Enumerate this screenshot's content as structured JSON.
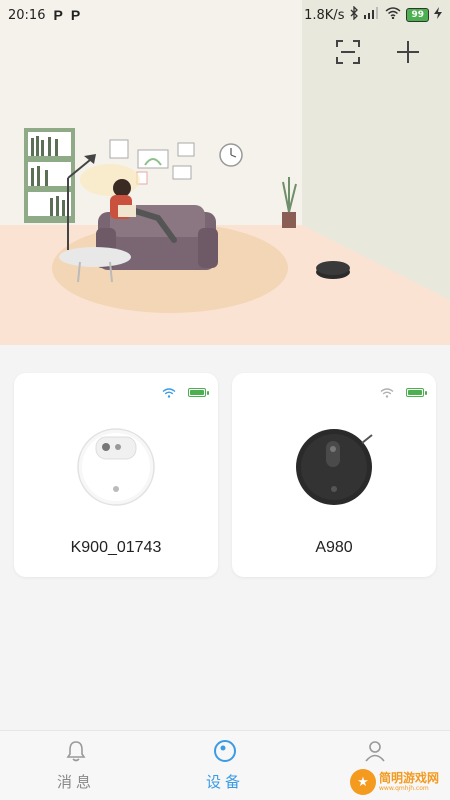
{
  "status_bar": {
    "time": "20:16",
    "app_icons": [
      "P",
      "P"
    ],
    "net_speed": "1.8K/s",
    "battery": "99"
  },
  "header": {
    "icons": [
      "scan-icon",
      "add-icon"
    ]
  },
  "devices": [
    {
      "name": "K900_01743",
      "wifi_color": "#3b9be5",
      "battery_color": "#4caf50",
      "battery_level": 1.0,
      "robot_color": "white"
    },
    {
      "name": "A980",
      "wifi_color": "#b0b0b0",
      "battery_color": "#4caf50",
      "battery_level": 1.0,
      "robot_color": "black"
    }
  ],
  "tabbar": {
    "tabs": [
      {
        "label": "消息",
        "icon": "bell-icon",
        "active": false
      },
      {
        "label": "设备",
        "icon": "device-icon",
        "active": true
      },
      {
        "label": "",
        "icon": "user-icon",
        "active": false
      }
    ]
  },
  "watermark": {
    "cn": "简明游戏网",
    "en": "www.qmhjh.com"
  },
  "colors": {
    "accent": "#3b9be5",
    "inactive": "#888888",
    "battery": "#4caf50"
  }
}
